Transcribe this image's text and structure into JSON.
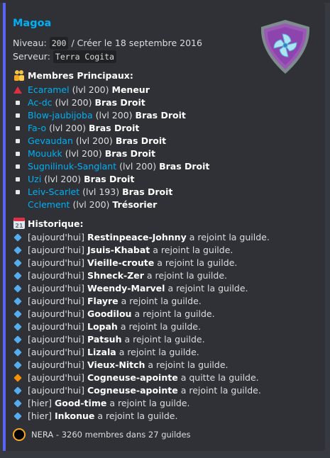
{
  "embed": {
    "title": "Magoa",
    "niveau_label": "Niveau:",
    "niveau_value": "200",
    "creation_text": "/ Créer le 18 septembre 2016",
    "serveur_label": "Serveur:",
    "serveur_value": "Terra Cogita",
    "accent_color": "#5865f2",
    "thumbnail": "guild-emblem-shield"
  },
  "members_section": {
    "title": "Membres Principaux:",
    "icon": "people-icon",
    "members": [
      {
        "name": "Ecaramel",
        "level": "(lvl 200)",
        "role": "Meneur",
        "bullet": "red-triangle",
        "linked": true
      },
      {
        "name": "Ac-dc",
        "level": "(lvl 200)",
        "role": "Bras Droit",
        "bullet": "white-square",
        "linked": true
      },
      {
        "name": "Blow-jaubijoba",
        "level": "(lvl 200)",
        "role": "Bras Droit",
        "bullet": "white-square",
        "linked": true
      },
      {
        "name": "Fa-o",
        "level": "(lvl 200)",
        "role": "Bras Droit",
        "bullet": "white-square",
        "linked": true
      },
      {
        "name": "Gevaudan",
        "level": "(lvl 200)",
        "role": "Bras Droit",
        "bullet": "white-square",
        "linked": true
      },
      {
        "name": "Mouukk",
        "level": "(lvl 200)",
        "role": "Bras Droit",
        "bullet": "white-square",
        "linked": true
      },
      {
        "name": "Sugnilinuk-Sanglant",
        "level": "(lvl 200)",
        "role": "Bras Droit",
        "bullet": "white-square",
        "linked": true
      },
      {
        "name": "Uzi",
        "level": "(lvl 200)",
        "role": "Bras Droit",
        "bullet": "white-square",
        "linked": true
      },
      {
        "name": "Leiv-Scarlet",
        "level": "(lvl 193)",
        "role": "Bras Droit",
        "bullet": "white-square",
        "linked": true
      },
      {
        "name": "Cclement",
        "level": "(lvl 200)",
        "role": "Trésorier",
        "bullet": "none",
        "linked": true
      }
    ]
  },
  "history_section": {
    "title": "Historique:",
    "icon": "calendar-icon",
    "calendar_day": "21",
    "entries": [
      {
        "when": "[aujourd'hui]",
        "name": "Restinpeace-Johnny",
        "action": "a rejoint la guilde.",
        "bullet": "blue"
      },
      {
        "when": "[aujourd'hui]",
        "name": "Jsuis-Khabat",
        "action": "a rejoint la guilde.",
        "bullet": "blue"
      },
      {
        "when": "[aujourd'hui]",
        "name": "Vieille-croute",
        "action": "a rejoint la guilde.",
        "bullet": "blue"
      },
      {
        "when": "[aujourd'hui]",
        "name": "Shneck-Zer",
        "action": "a rejoint la guilde.",
        "bullet": "blue"
      },
      {
        "when": "[aujourd'hui]",
        "name": "Weendy-Marvel",
        "action": "a rejoint la guilde.",
        "bullet": "blue"
      },
      {
        "when": "[aujourd'hui]",
        "name": "Flayre",
        "action": "a rejoint la guilde.",
        "bullet": "blue"
      },
      {
        "when": "[aujourd'hui]",
        "name": "Goodilou",
        "action": "a rejoint la guilde.",
        "bullet": "blue"
      },
      {
        "when": "[aujourd'hui]",
        "name": "Lopah",
        "action": "a rejoint la guilde.",
        "bullet": "blue"
      },
      {
        "when": "[aujourd'hui]",
        "name": "Patsuh",
        "action": "a rejoint la guilde.",
        "bullet": "blue"
      },
      {
        "when": "[aujourd'hui]",
        "name": "Lizala",
        "action": "a rejoint la guilde.",
        "bullet": "blue"
      },
      {
        "when": "[aujourd'hui]",
        "name": "Vieux-Nitch",
        "action": "a rejoint la guilde.",
        "bullet": "blue"
      },
      {
        "when": "[aujourd'hui]",
        "name": "Cogneuse-apointe",
        "action": "a quitte la guilde.",
        "bullet": "orange"
      },
      {
        "when": "[aujourd'hui]",
        "name": "Cogneuse-apointe",
        "action": "a rejoint la guilde.",
        "bullet": "blue"
      },
      {
        "when": "[hier]",
        "name": "Good-time",
        "action": "a rejoint la guilde.",
        "bullet": "blue"
      },
      {
        "when": "[hier]",
        "name": "Inkonue",
        "action": "a rejoint la guilde.",
        "bullet": "blue"
      }
    ]
  },
  "footer": {
    "text": "NERA -  3260 membres  dans  27 guildes",
    "icon": "nera-avatar-icon"
  },
  "colors": {
    "blue_diamond": "#55acee",
    "orange_diamond": "#f4900c",
    "link": "#00b0f4"
  }
}
